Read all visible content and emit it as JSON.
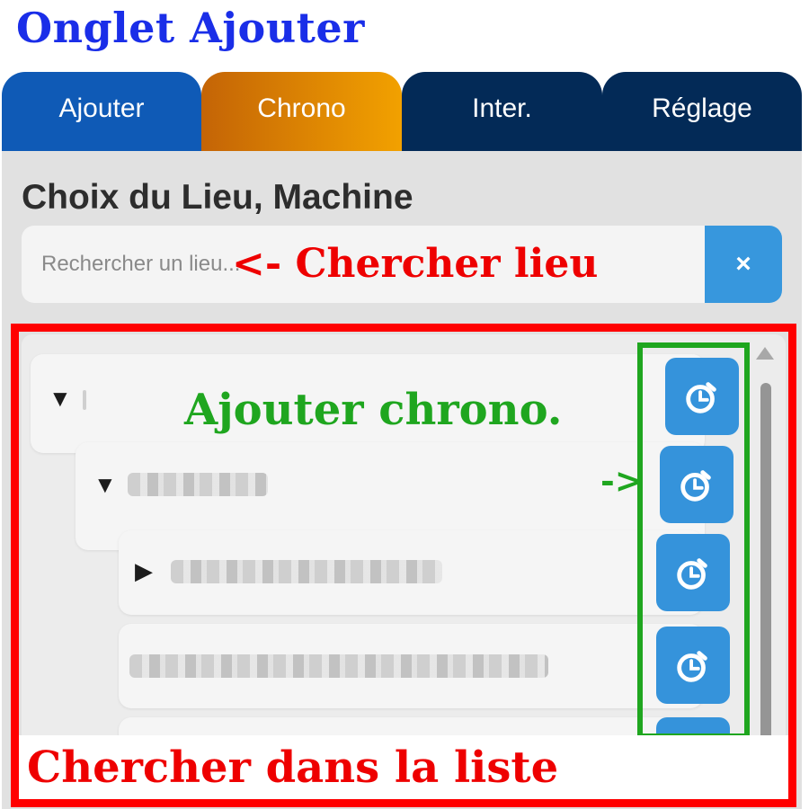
{
  "annotations": {
    "title": "Onglet Ajouter",
    "search": "<- Chercher lieu",
    "chrono": "Ajouter chrono.",
    "chrono_arrow": "->",
    "list": "Chercher dans la liste"
  },
  "tabs": [
    {
      "label": "Ajouter",
      "color": "#0f5ab6"
    },
    {
      "label": "Chrono",
      "color": "#f2a100"
    },
    {
      "label": "Inter.",
      "color": "#032a57"
    },
    {
      "label": "Réglage",
      "color": "#032a57"
    }
  ],
  "section": {
    "title": "Choix du Lieu, Machine"
  },
  "search": {
    "placeholder": "Rechercher un lieu...",
    "value": "",
    "clear_label": "×"
  },
  "tree": {
    "expanded_arrow": "▼",
    "collapsed_arrow": "▶"
  },
  "chrono_buttons": {
    "icon": "stopwatch-icon",
    "count": 5
  },
  "colors": {
    "accent": "#3593db",
    "annotation_red": "#ee0000",
    "annotation_green": "#1fa61f",
    "annotation_blue": "#1a2ee8"
  }
}
